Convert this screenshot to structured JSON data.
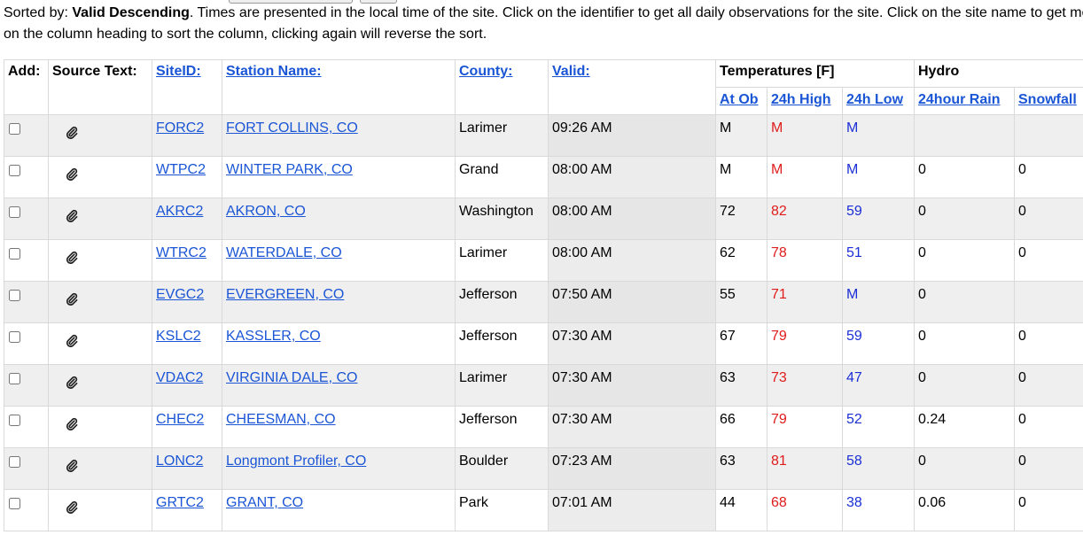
{
  "intro": {
    "sorted_prefix": "Sorted by: ",
    "sorted_value": "Valid Descending",
    "line1_rest": ". Times are presented in the local time of the site. Click on the identifier to get all daily observations for the site. Click on the site name to get more",
    "line2": "on the column heading to sort the column, clicking again will reverse the sort."
  },
  "table": {
    "group_headers": {
      "temperatures": "Temperatures [F]",
      "hydro": "Hydro"
    },
    "columns": {
      "add": "Add:",
      "source_text": "Source Text:",
      "site_id": "SiteID:",
      "station_name": "Station Name:",
      "county": "County:",
      "valid": "Valid:",
      "at_ob": "At Ob",
      "high_24h": "24h High",
      "low_24h": "24h Low",
      "rain_24h": "24hour Rain",
      "snowfall": "Snowfall"
    },
    "rows": [
      {
        "id": "FORC2",
        "name": "FORT COLLINS, CO",
        "county": "Larimer",
        "valid": "09:26 AM",
        "atob": "M",
        "high": "M",
        "low": "M",
        "rain": "",
        "snow": ""
      },
      {
        "id": "WTPC2",
        "name": "WINTER PARK, CO",
        "county": "Grand",
        "valid": "08:00 AM",
        "atob": "M",
        "high": "M",
        "low": "M",
        "rain": "0",
        "snow": "0"
      },
      {
        "id": "AKRC2",
        "name": "AKRON, CO",
        "county": "Washington",
        "valid": "08:00 AM",
        "atob": "72",
        "high": "82",
        "low": "59",
        "rain": "0",
        "snow": "0"
      },
      {
        "id": "WTRC2",
        "name": "WATERDALE, CO",
        "county": "Larimer",
        "valid": "08:00 AM",
        "atob": "62",
        "high": "78",
        "low": "51",
        "rain": "0",
        "snow": "0"
      },
      {
        "id": "EVGC2",
        "name": "EVERGREEN, CO",
        "county": "Jefferson",
        "valid": "07:50 AM",
        "atob": "55",
        "high": "71",
        "low": "M",
        "rain": "0",
        "snow": ""
      },
      {
        "id": "KSLC2",
        "name": "KASSLER, CO",
        "county": "Jefferson",
        "valid": "07:30 AM",
        "atob": "67",
        "high": "79",
        "low": "59",
        "rain": "0",
        "snow": "0"
      },
      {
        "id": "VDAC2",
        "name": "VIRGINIA DALE, CO",
        "county": "Larimer",
        "valid": "07:30 AM",
        "atob": "63",
        "high": "73",
        "low": "47",
        "rain": "0",
        "snow": "0"
      },
      {
        "id": "CHEC2",
        "name": "CHEESMAN, CO",
        "county": "Jefferson",
        "valid": "07:30 AM",
        "atob": "66",
        "high": "79",
        "low": "52",
        "rain": "0.24",
        "snow": "0"
      },
      {
        "id": "LONC2",
        "name": "Longmont Profiler, CO",
        "county": "Boulder",
        "valid": "07:23 AM",
        "atob": "63",
        "high": "81",
        "low": "58",
        "rain": "0",
        "snow": "0"
      },
      {
        "id": "GRTC2",
        "name": "GRANT, CO",
        "county": "Park",
        "valid": "07:01 AM",
        "atob": "44",
        "high": "68",
        "low": "38",
        "rain": "0.06",
        "snow": "0"
      }
    ]
  },
  "icons": {
    "source_text": "paperclip-icon"
  },
  "colors": {
    "link": "#1a55d6",
    "high_temp": "#e01b1b",
    "low_temp": "#1a2fd6"
  }
}
